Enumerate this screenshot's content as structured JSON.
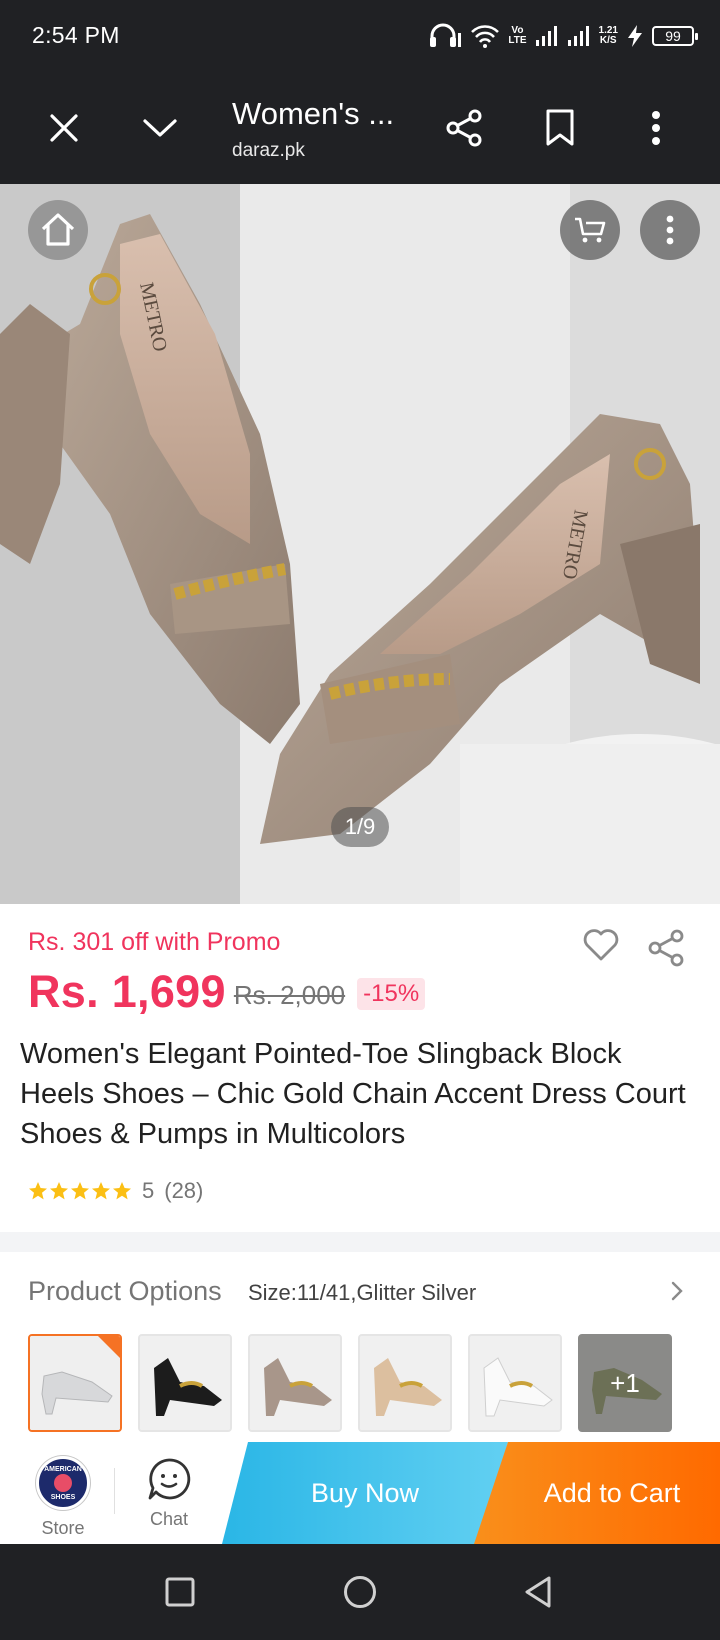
{
  "status_bar": {
    "time": "2:54 PM",
    "network_speed": "1.21",
    "network_speed_unit": "K/S",
    "battery": "99",
    "volte": "Vo",
    "lte": "LTE"
  },
  "browser": {
    "title": "Women's ...",
    "url": "daraz.pk",
    "icons": [
      "close-icon",
      "chevron-down-icon",
      "share-icon",
      "bookmark-icon",
      "more-vert-icon"
    ]
  },
  "gallery": {
    "counter": "1/9",
    "brand_on_shoe": "METRO",
    "brand_on_shoe_2": "METRO",
    "icons": [
      "home-icon",
      "cart-icon",
      "more-vert-icon"
    ]
  },
  "product": {
    "promo": "Rs. 301 off with Promo",
    "price": "Rs. 1,699",
    "original_price": "Rs. 2,000",
    "discount": "-15%",
    "title": "Women's Elegant Pointed-Toe Slingback Block Heels Shoes – Chic Gold Chain Accent Dress Court Shoes & Pumps in Multicolors",
    "rating": "5",
    "rating_count": "(28)",
    "stars": 5
  },
  "options": {
    "label": "Product Options",
    "value": "Size:11/41,Glitter Silver",
    "more": "+1",
    "thumbnails": [
      "Glitter Silver",
      "Black",
      "Taupe",
      "Beige",
      "White",
      "Olive"
    ]
  },
  "actions": {
    "store_label": "Store",
    "store_logo_top": "AMERICAN",
    "store_logo_bottom": "SHOES",
    "chat_label": "Chat",
    "buy_now": "Buy Now",
    "add_to_cart": "Add to Cart"
  },
  "colors": {
    "accent_red": "#f0345d",
    "buy_blue": "#2ab6e6",
    "cart_orange": "#ff6a00",
    "star": "#fbbf14"
  }
}
